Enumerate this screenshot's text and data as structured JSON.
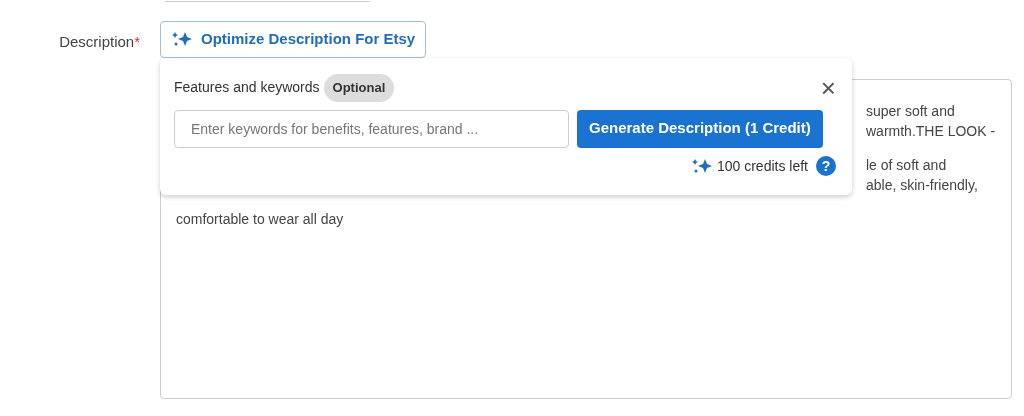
{
  "field_label": {
    "text": "Description",
    "required_mark": "*"
  },
  "optimize_button": {
    "label": "Optimize Description For Etsy"
  },
  "description_text": [
    {
      "kind": "tail",
      "lines": [
        "super soft and",
        "warmth.THE LOOK -"
      ]
    },
    {
      "kind": "tail",
      "lines": [
        "le of soft and",
        "able, skin-friendly,"
      ]
    },
    {
      "kind": "full",
      "lines": [
        "comfortable to wear all day"
      ]
    }
  ],
  "popup": {
    "title": "Features and keywords",
    "badge": "Optional",
    "close": "×",
    "keywords_field": {
      "placeholder": "Enter keywords for benefits, features, brand ..."
    },
    "generate_button": {
      "label": "Generate Description (1 Credit)"
    },
    "credits": "100 credits left",
    "help": "?"
  }
}
